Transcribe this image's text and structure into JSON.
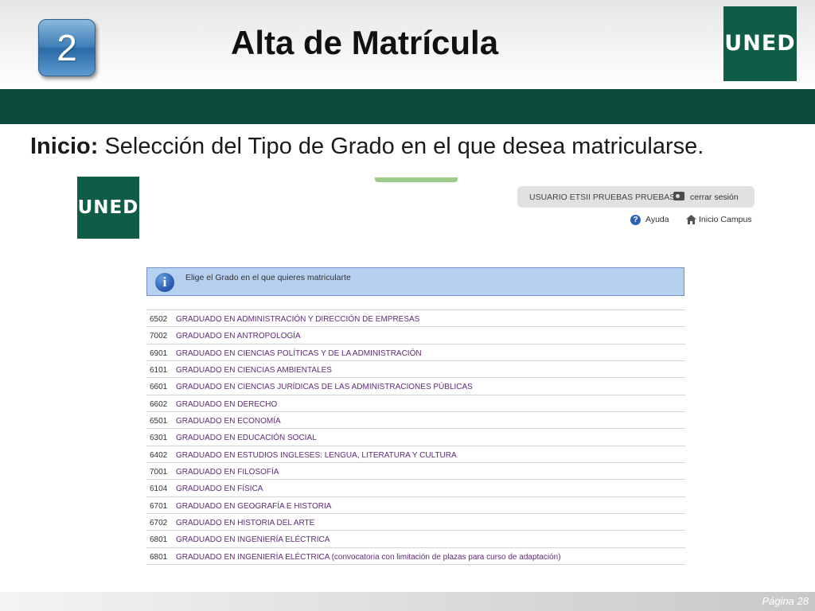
{
  "slide": {
    "step_number": "2",
    "title": "Alta de Matrícula",
    "logo_text": "UNED",
    "subtitle_bold": "Inicio:",
    "subtitle_rest": " Selección del Tipo de Grado en el que desea matricularse.",
    "page_label": "Página 28",
    "colors": {
      "brand_green": "#0d4a3b",
      "link_purple": "#5e2b77",
      "info_blue": "#b7d0ef"
    }
  },
  "app": {
    "logo_text": "UNED",
    "user": {
      "name": "USUARIO ETSII PRUEBAS PRUEBAS",
      "logout": "cerrar sesión"
    },
    "links": {
      "help": "Ayuda",
      "home": "Inicio Campus"
    },
    "info_message": "Elige el Grado en el que quieres matricularte",
    "degrees": [
      {
        "code": "6502",
        "name": "GRADUADO EN ADMINISTRACIÓN Y DIRECCIÓN DE EMPRESAS"
      },
      {
        "code": "7002",
        "name": "GRADUADO EN ANTROPOLOGÍA"
      },
      {
        "code": "6901",
        "name": "GRADUADO EN CIENCIAS POLÍTICAS Y DE LA ADMINISTRACIÓN"
      },
      {
        "code": "6101",
        "name": "GRADUADO EN CIENCIAS AMBIENTALES"
      },
      {
        "code": "6601",
        "name": "GRADUADO EN CIENCIAS JURÍDICAS DE LAS ADMINISTRACIONES PÚBLICAS"
      },
      {
        "code": "6602",
        "name": "GRADUADO EN DERECHO"
      },
      {
        "code": "6501",
        "name": "GRADUADO EN ECONOMÍA"
      },
      {
        "code": "6301",
        "name": "GRADUADO EN EDUCACIÓN SOCIAL"
      },
      {
        "code": "6402",
        "name": "GRADUADO EN ESTUDIOS INGLESES: LENGUA, LITERATURA Y CULTURA"
      },
      {
        "code": "7001",
        "name": "GRADUADO EN FILOSOFÍA"
      },
      {
        "code": "6104",
        "name": "GRADUADO EN FÍSICA"
      },
      {
        "code": "6701",
        "name": "GRADUADO EN GEOGRAFÍA E HISTORIA"
      },
      {
        "code": "6702",
        "name": "GRADUADO EN HISTORIA DEL ARTE"
      },
      {
        "code": "6801",
        "name": "GRADUADO EN INGENIERÍA ELÉCTRICA"
      },
      {
        "code": "6801",
        "name": "GRADUADO EN INGENIERÍA ELÉCTRICA (convocatoria con limitación de plazas para curso de adaptación)"
      }
    ]
  }
}
